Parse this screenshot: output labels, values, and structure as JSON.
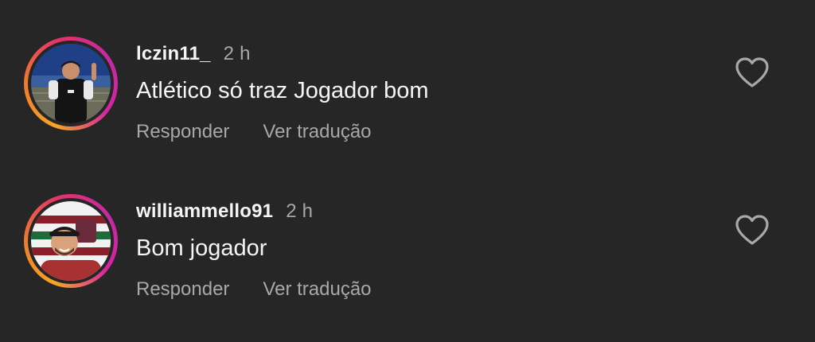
{
  "comments": [
    {
      "username": "lczin11_",
      "time": "2 h",
      "text": "Atlético só traz Jogador bom",
      "reply_label": "Responder",
      "translate_label": "Ver tradução",
      "like_icon": "heart-outline-icon"
    },
    {
      "username": "williammello91",
      "time": "2 h",
      "text": "Bom jogador",
      "reply_label": "Responder",
      "translate_label": "Ver tradução",
      "like_icon": "heart-outline-icon"
    }
  ],
  "colors": {
    "background": "#262626",
    "primary_text": "#f5f5f5",
    "secondary_text": "#a8a8a8",
    "story_ring": [
      "#f5a623",
      "#e2336b",
      "#c32aa3"
    ]
  }
}
